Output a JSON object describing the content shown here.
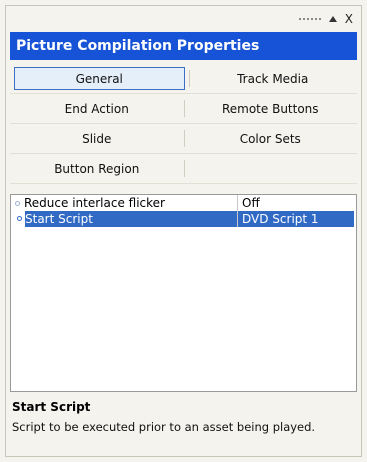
{
  "panel": {
    "title": "Picture Compilation Properties"
  },
  "controls": {
    "grip_icon": "grip-dots",
    "collapse_icon": "triangle-up",
    "close_glyph": "X"
  },
  "tabs": [
    [
      "General",
      "Track Media"
    ],
    [
      "End Action",
      "Remote Buttons"
    ],
    [
      "Slide",
      "Color Sets"
    ],
    [
      "Button Region",
      ""
    ]
  ],
  "properties": [
    {
      "name": "Reduce interlace flicker",
      "value": "Off",
      "selected": false
    },
    {
      "name": "Start Script",
      "value": "DVD Script 1",
      "selected": true
    }
  ],
  "description": {
    "title": "Start Script",
    "text": "Script to be executed prior to an asset being played."
  },
  "colors": {
    "header_bg": "#1753d6",
    "selection": "#316ac5"
  }
}
